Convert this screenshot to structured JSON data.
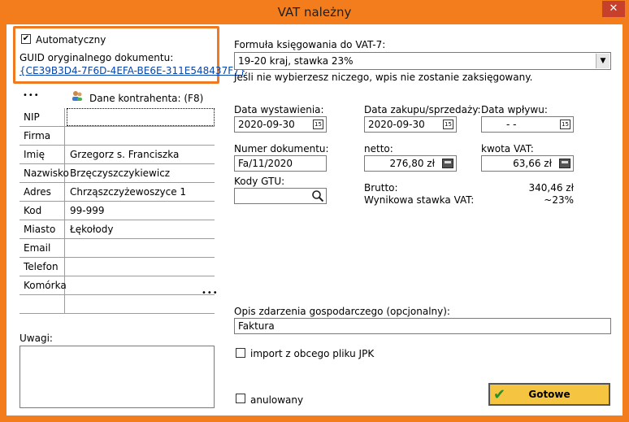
{
  "window": {
    "title": "VAT należny",
    "close_glyph": "✕"
  },
  "document_source": {
    "automatic_label": "Automatyczny",
    "automatic_checked": true,
    "guid_label": "GUID oryginalnego dokumentu:",
    "guid_value": "{CE39B3D4-7F6D-4EFA-BE6E-311E548437F7}"
  },
  "contractor": {
    "menu_glyph": "•••",
    "header_label": "Dane kontrahenta: (F8)",
    "icon": "people-icon",
    "rows": [
      {
        "label": "NIP",
        "value": ""
      },
      {
        "label": "Firma",
        "value": ""
      },
      {
        "label": "Imię",
        "value": "Grzegorz s. Franciszka"
      },
      {
        "label": "Nazwisko",
        "value": "Brzęczyszczykiewicz"
      },
      {
        "label": "Adres",
        "value": "Chrząszczyżewoszyce 1"
      },
      {
        "label": "Kod",
        "value": "99-999"
      },
      {
        "label": "Miasto",
        "value": "Łękołody"
      },
      {
        "label": "Email",
        "value": ""
      },
      {
        "label": "Telefon",
        "value": ""
      },
      {
        "label": "Komórka",
        "value": ""
      }
    ],
    "more_glyph": "•••"
  },
  "notes": {
    "label": "Uwagi:",
    "value": ""
  },
  "vat7": {
    "label": "Formuła księgowania do VAT-7:",
    "selected": "19-20 kraj, stawka 23%",
    "hint": "Jeśli nie wybierzesz niczego, wpis nie zostanie zaksięgowany."
  },
  "dates": {
    "issue_label": "Data wystawienia:",
    "issue_value": "2020-09-30",
    "purchase_label": "Data zakupu/sprzedaży:",
    "purchase_value": "2020-09-30",
    "receipt_label": "Data wpływu:",
    "receipt_value": "- -",
    "calendar_glyph": "15"
  },
  "amounts": {
    "doc_number_label": "Numer dokumentu:",
    "doc_number_value": "Fa/11/2020",
    "net_label": "netto:",
    "net_value": "276,80 zł",
    "vat_label": "kwota VAT:",
    "vat_value": "63,66 zł",
    "gross_label": "Brutto:",
    "gross_value": "340,46 zł",
    "rate_label": "Wynikowa stawka VAT:",
    "rate_value": "~23%"
  },
  "gtu": {
    "label": "Kody GTU:",
    "value": ""
  },
  "description": {
    "label": "Opis zdarzenia gospodarczego (opcjonalny):",
    "value": "Faktura"
  },
  "jpk_import": {
    "label": "import z obcego pliku JPK",
    "checked": false
  },
  "cancelled": {
    "label": "anulowany",
    "checked": false
  },
  "submit": {
    "label": "Gotowe",
    "icon_glyph": "✔"
  },
  "colors": {
    "accent": "#f37d1c",
    "button": "#f5c542",
    "link": "#0645ad"
  }
}
